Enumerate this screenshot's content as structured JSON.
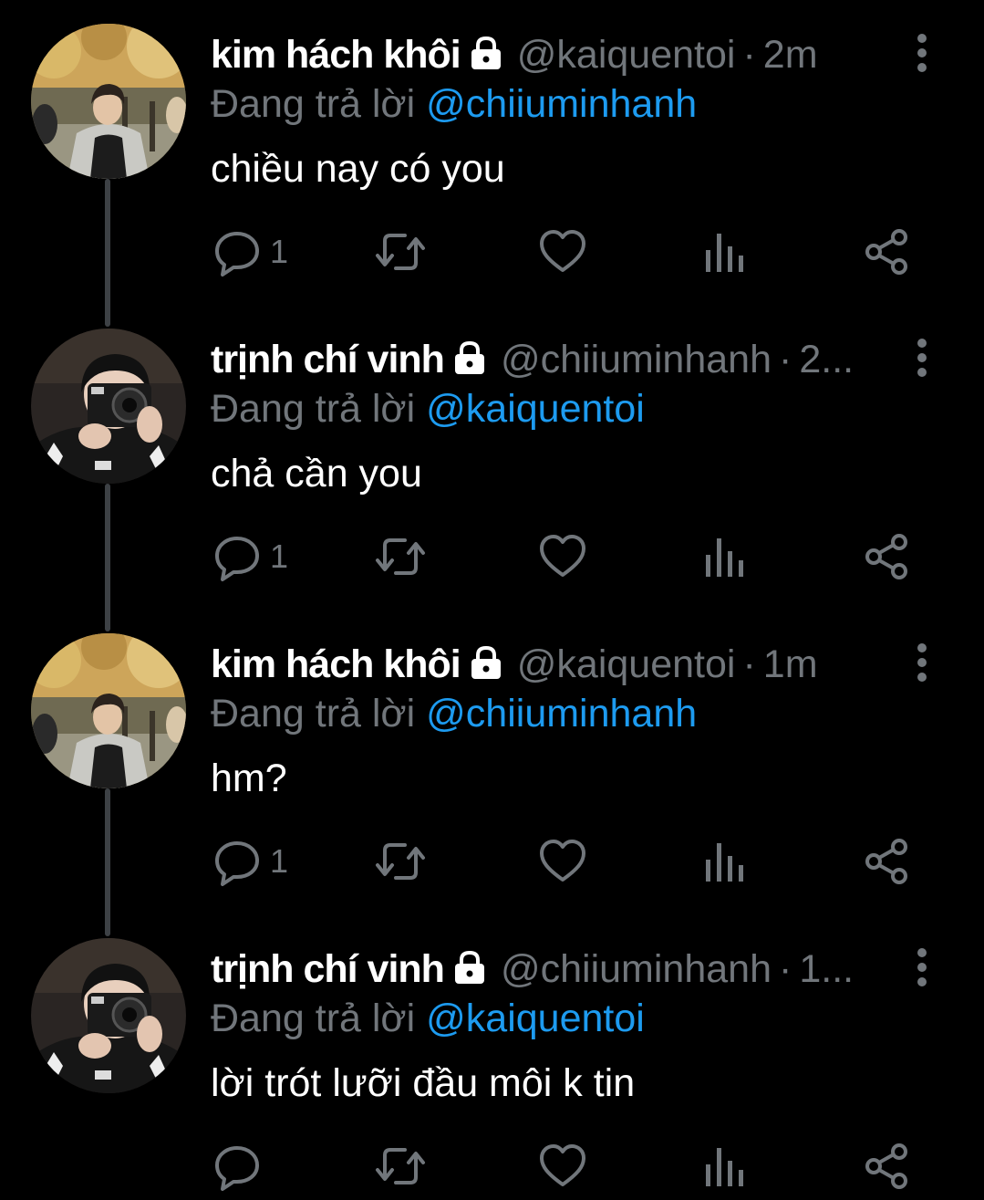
{
  "colors": {
    "background": "#000000",
    "primary_text": "#ffffff",
    "secondary_text": "#71767b",
    "mention": "#1d9bf0",
    "thread_line": "#3d4145"
  },
  "reply_prefix": "Đang trả lời",
  "tweets": [
    {
      "display_name": "kim hách khôi",
      "handle": "@kaiquentoi",
      "time": "2m",
      "reply_to": "@chiiuminhanh",
      "text": "chiều nay có you",
      "reply_count": "1",
      "avatar": "avatar-khoi",
      "protected_icon": "lock-icon"
    },
    {
      "display_name": "trịnh chí vinh",
      "handle": "@chiiuminhanh",
      "time": "2...",
      "reply_to": "@kaiquentoi",
      "text": "chả cần you",
      "reply_count": "1",
      "avatar": "avatar-vinh",
      "protected_icon": "lock-icon"
    },
    {
      "display_name": "kim hách khôi",
      "handle": "@kaiquentoi",
      "time": "1m",
      "reply_to": "@chiiuminhanh",
      "text": "hm?",
      "reply_count": "1",
      "avatar": "avatar-khoi",
      "protected_icon": "lock-icon"
    },
    {
      "display_name": "trịnh chí vinh",
      "handle": "@chiiuminhanh",
      "time": "1...",
      "reply_to": "@kaiquentoi",
      "text": "lời trót lưỡi đầu môi k tin",
      "reply_count": "",
      "avatar": "avatar-vinh",
      "protected_icon": "lock-icon"
    }
  ],
  "action_icons": [
    "reply-icon",
    "retweet-icon",
    "like-icon",
    "views-icon",
    "share-icon"
  ]
}
